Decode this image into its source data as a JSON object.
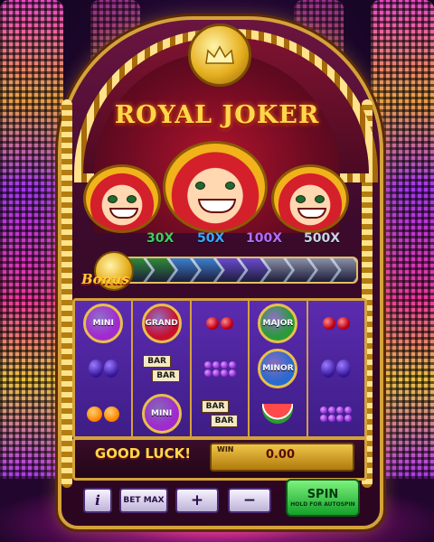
{
  "game": {
    "title": "ROYAL JOKER",
    "multipliers": [
      {
        "label": "30X",
        "color": "#3ecf5a"
      },
      {
        "label": "50X",
        "color": "#3aa8ff"
      },
      {
        "label": "100X",
        "color": "#b46cff"
      },
      {
        "label": "500X",
        "color": "#c9d3e6"
      }
    ],
    "bonus_label": "Bonus",
    "bonus_segment_colors": [
      "#2f8a3a",
      "#2f8a3a",
      "#3a7fd0",
      "#3a7fd0",
      "#6a4ad0",
      "#6a4ad0",
      "#8a8fa8",
      "#8a8fa8",
      "#8a8fa8",
      "#8a8fa8"
    ],
    "reels": [
      [
        {
          "type": "jackpot",
          "label": "MINI",
          "color": "#a02ad0"
        },
        {
          "type": "plum"
        },
        {
          "type": "orange"
        }
      ],
      [
        {
          "type": "jackpot",
          "label": "GRAND",
          "color": "#c8102e"
        },
        {
          "type": "bar"
        },
        {
          "type": "jackpot",
          "label": "MINI",
          "color": "#a02ad0"
        }
      ],
      [
        {
          "type": "cherry"
        },
        {
          "type": "grape"
        },
        {
          "type": "bar"
        }
      ],
      [
        {
          "type": "jackpot",
          "label": "MAJOR",
          "color": "#2a9a3a"
        },
        {
          "type": "jackpot",
          "label": "MINOR",
          "color": "#2a6ad0"
        },
        {
          "type": "watermelon"
        }
      ],
      [
        {
          "type": "cherry"
        },
        {
          "type": "plum"
        },
        {
          "type": "grape"
        }
      ]
    ],
    "bar_text": "BAR",
    "status_message": "GOOD LUCK!",
    "win_label": "WIN",
    "win_value": "0.00",
    "buttons": {
      "info": "i",
      "bet_max": "BET MAX",
      "plus": "+",
      "minus": "−",
      "spin": "SPIN",
      "spin_sub": "HOLD FOR AUTOSPIN"
    },
    "colors": {
      "gold": "#d4a23a",
      "accent": "#ffd84a"
    }
  }
}
